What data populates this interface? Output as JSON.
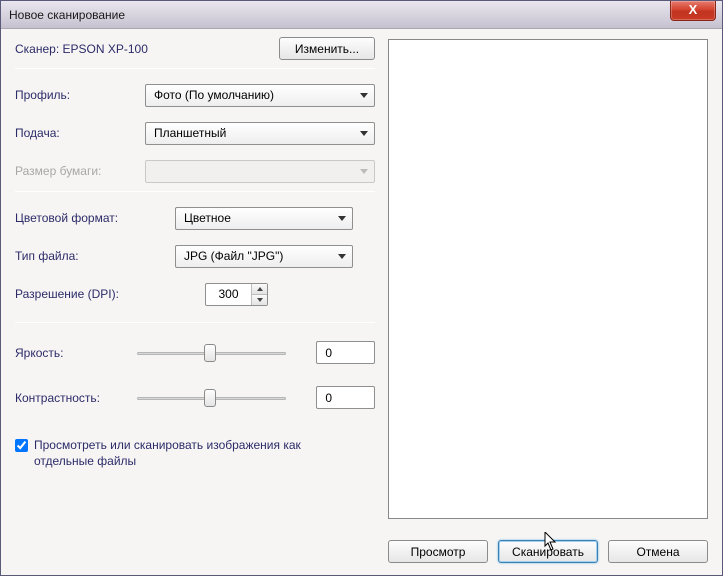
{
  "window": {
    "title": "Новое сканирование",
    "close_x": "X"
  },
  "scanner": {
    "prefix": "Сканер:",
    "name": "EPSON XP-100",
    "change_btn": "Изменить..."
  },
  "labels": {
    "profile": "Профиль:",
    "feed": "Подача:",
    "paper_size": "Размер бумаги:",
    "color_format": "Цветовой формат:",
    "file_type": "Тип файла:",
    "resolution": "Разрешение (DPI):",
    "brightness": "Яркость:",
    "contrast": "Контрастность:"
  },
  "values": {
    "profile": "Фото (По умолчанию)",
    "feed": "Планшетный",
    "paper_size": "",
    "color_format": "Цветное",
    "file_type": "JPG (Файл \"JPG\")",
    "resolution": "300",
    "brightness": "0",
    "contrast": "0"
  },
  "checkbox": {
    "label": "Просмотреть или сканировать изображения как отдельные файлы",
    "checked": true
  },
  "buttons": {
    "preview": "Просмотр",
    "scan": "Сканировать",
    "cancel": "Отмена"
  }
}
